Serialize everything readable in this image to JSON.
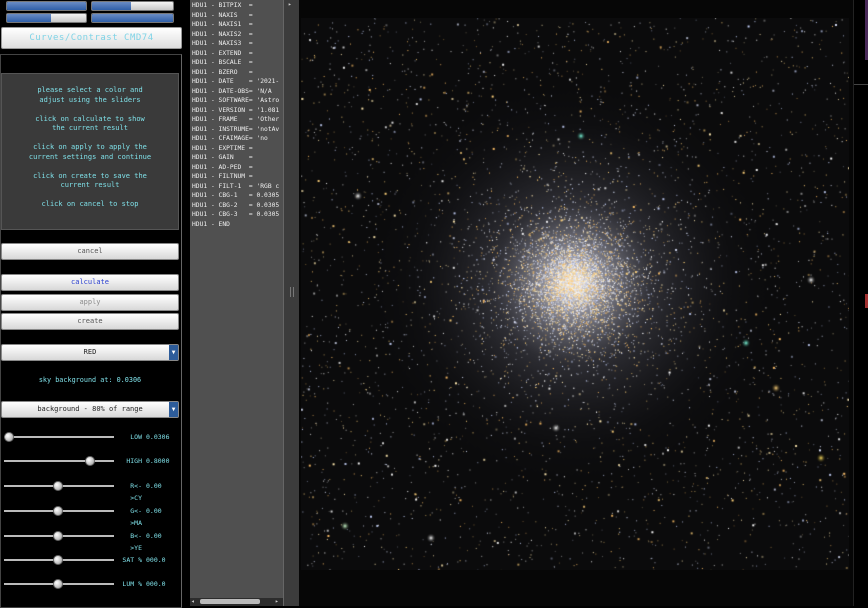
{
  "top_sliders": [
    {
      "fill": 1.0
    },
    {
      "fill": 0.48
    },
    {
      "fill": 0.56
    },
    {
      "fill": 1.0
    }
  ],
  "curves_button": {
    "label": "Curves/Contrast CMD74"
  },
  "help_text": [
    "please select a color and",
    "adjust using the sliders",
    "",
    "click on calculate to show",
    "the  current result",
    "",
    "click on apply to apply the",
    "current settings and continue",
    "",
    "click on create to save the",
    "current result",
    "",
    "click on cancel to stop"
  ],
  "buttons": {
    "cancel": "cancel",
    "calculate": "calculate",
    "apply": "apply",
    "create": "create"
  },
  "color_select": {
    "value": "RED"
  },
  "sky_background": "sky background at: 0.0306",
  "background_select": {
    "value": "background -  80% of range"
  },
  "sliders": [
    {
      "label": "LOW",
      "value": "0.0306",
      "level": 0.04
    },
    {
      "label": "HIGH",
      "value": "0.8000",
      "level": 0.8
    },
    {
      "label": "R<->CY",
      "value": "0.00",
      "level": 0.5
    },
    {
      "label": "G<->MA",
      "value": "0.00",
      "level": 0.5
    },
    {
      "label": "B<->YE",
      "value": "0.00",
      "level": 0.5
    },
    {
      "label": "SAT %",
      "value": "000.0",
      "level": 0.5
    },
    {
      "label": "LUM %",
      "value": "000.0",
      "level": 0.5
    }
  ],
  "header_lines": [
    "HDU1 - BITPIX  =",
    "HDU1 - NAXIS   =",
    "HDU1 - NAXIS1  =",
    "HDU1 - NAXIS2  =",
    "HDU1 - NAXIS3  =",
    "HDU1 - EXTEND  =",
    "HDU1 - BSCALE  =",
    "HDU1 - BZERO   =",
    "HDU1 - DATE    = '2021-",
    "HDU1 - DATE-OBS= 'N/A",
    "HDU1 - SOFTWARE= 'Astro",
    "HDU1 - VERSION = '1.081",
    "HDU1 - FRAME   = 'Other",
    "HDU1 - INSTRUME= 'notAv",
    "HDU1 - CFAIMAGE= 'no",
    "HDU1 - EXPTIME =",
    "HDU1 - GAIN    =",
    "HDU1 - AD-PED  =",
    "HDU1 - FILTNUM =",
    "HDU1 - FILT-1  = 'RGB c",
    "HDU1 - CBG-1   = 0.0305",
    "HDU1 - CBG-2   = 0.0305",
    "HDU1 - CBG-3   = 0.0305",
    "HDU1 - END"
  ],
  "colors": {
    "panel_text": "#7fe0e8",
    "header_bg": "#505050",
    "accent_blue": "#2d5c9a"
  }
}
